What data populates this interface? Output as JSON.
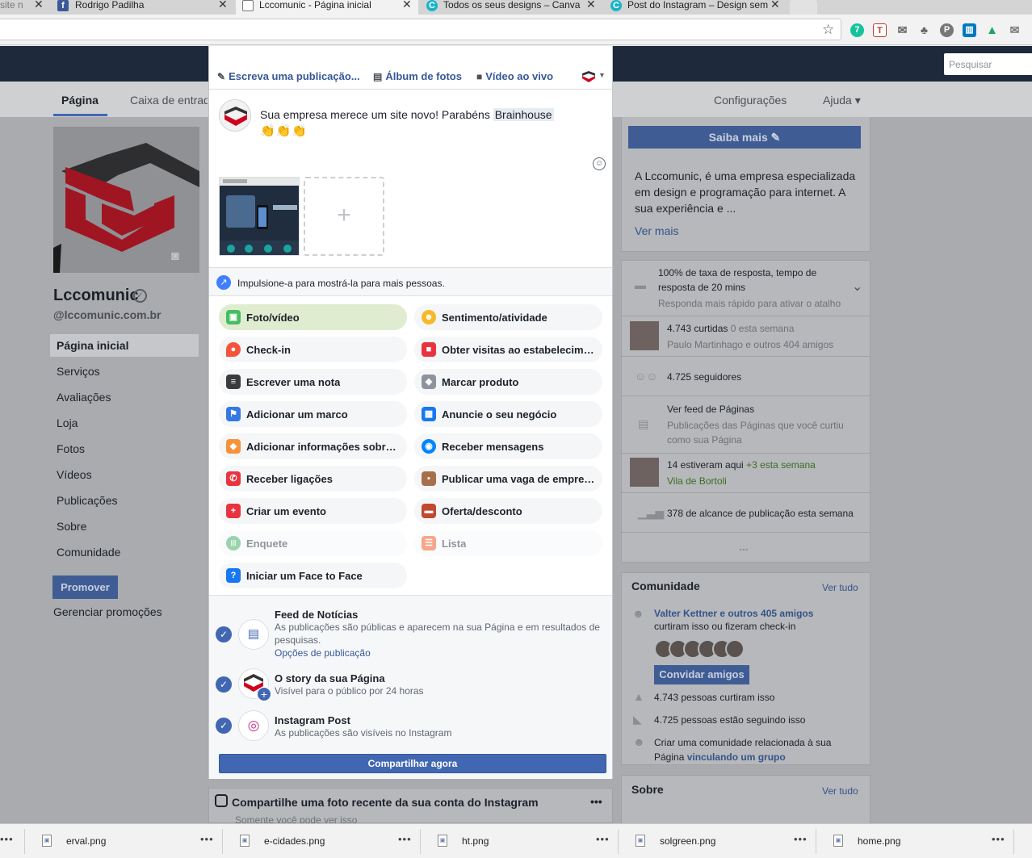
{
  "browser": {
    "tabs": [
      {
        "label": "site n",
        "favicon": ""
      },
      {
        "label": "Rodrigo Padilha",
        "favicon": "f"
      },
      {
        "label": "Lccomunic - Página inicial",
        "favicon": ""
      },
      {
        "label": "Todos os seus designs – Canva",
        "favicon": "C"
      },
      {
        "label": "Post do Instagram – Design sem",
        "favicon": "C"
      }
    ],
    "close_glyph": "✕",
    "extension_badge": "7"
  },
  "fb": {
    "search_placeholder": "Pesquisar",
    "subnav": {
      "pagina": "Página",
      "caixa": "Caixa de entrada",
      "configuracoes": "Configurações",
      "ajuda": "Ajuda ▾"
    },
    "page_name": "Lccomunic",
    "page_handle": "@lccomunic.com.br",
    "left_nav": [
      "Página inicial",
      "Serviços",
      "Avaliações",
      "Loja",
      "Fotos",
      "Vídeos",
      "Publicações",
      "Sobre",
      "Comunidade"
    ],
    "promote_label": "Promover",
    "manage_promotions": "Gerenciar promoções",
    "right": {
      "saiba_mais": "Saiba mais ✎",
      "about_text": "A Lccomunic, é uma empresa especializada em design e programação para internet. A sua experiência e ...",
      "ver_mais": "Ver mais",
      "response_line1": "100% de taxa de resposta, tempo de",
      "response_line2": "resposta de 20 mins",
      "response_hint": "Responda mais rápido para ativar o atalho",
      "likes_count": "4.743 curtidas",
      "likes_week": "0 esta semana",
      "likes_friends": "Paulo Martinhago",
      "likes_friends_more": "e outros 404 amigos",
      "followers": "4.725 seguidores",
      "feed_title": "Ver feed de Páginas",
      "feed_sub": "Publicações das Páginas que você curtiu como sua Página",
      "checkins": "14 estiveram aqui",
      "checkins_week": "+3 esta semana",
      "checkins_place": "Vila de Bortoli",
      "reach": "378 de alcance de publicação esta semana",
      "more_dots": "...",
      "community_title": "Comunidade",
      "ver_tudo": "Ver tudo",
      "community_friends": "Valter Kettner e outros 405 amigos",
      "community_friends_sub": "curtiram isso ou fizeram check-in",
      "invite_friends": "Convidar amigos",
      "community_likes": "4.743 pessoas curtiram isso",
      "community_follows": "4.725 pessoas estão seguindo isso",
      "community_group_text": "Criar uma comunidade relacionada à sua Página",
      "community_group_link": "vinculando um grupo",
      "about_title": "Sobre",
      "about_ver_tudo": "Ver tudo"
    },
    "instagram_card_title": "Compartilhe uma foto recente da sua conta do Instagram",
    "instagram_card_sub": "Somente você pode ver isso"
  },
  "composer": {
    "tabs": [
      {
        "icon": "pencil-icon",
        "glyph": "✎",
        "label": "Escreva uma publicação..."
      },
      {
        "icon": "photo-album-icon",
        "glyph": "▤",
        "label": "Álbum de fotos"
      },
      {
        "icon": "video-camera-icon",
        "glyph": "■",
        "label": "Vídeo ao vivo"
      }
    ],
    "post_text": "Sua empresa merece um site novo! Parabéns",
    "mention": "Brainhouse",
    "clap_emoji": "👏👏👏",
    "add_media_glyph": "+",
    "boost_text": "Impulsione-a para mostrá-la para mais pessoas.",
    "actions": [
      {
        "label": "Foto/vídeo",
        "icon": "photo-video-icon",
        "glyph": "▣",
        "color": "#45bd62",
        "state": "selected"
      },
      {
        "label": "Sentimento/atividade",
        "icon": "smiley-icon",
        "glyph": "☻",
        "color": "#f7b928",
        "state": "normal"
      },
      {
        "label": "Check-in",
        "icon": "location-pin-icon",
        "glyph": "●",
        "color": "#f5533d",
        "state": "normal"
      },
      {
        "label": "Obter visitas ao estabelecimento",
        "icon": "shopping-bag-icon",
        "glyph": "■",
        "color": "#e9343f",
        "state": "normal"
      },
      {
        "label": "Escrever uma nota",
        "icon": "note-icon",
        "glyph": "≡",
        "color": "#3a3b3c",
        "state": "normal"
      },
      {
        "label": "Marcar produto",
        "icon": "tag-icon",
        "glyph": "◆",
        "color": "#8d949e",
        "state": "normal"
      },
      {
        "label": "Adicionar um marco",
        "icon": "flag-icon",
        "glyph": "⚑",
        "color": "#3578e5",
        "state": "normal"
      },
      {
        "label": "Anuncie o seu negócio",
        "icon": "ad-icon",
        "glyph": "▦",
        "color": "#1877f2",
        "state": "normal"
      },
      {
        "label": "Adicionar informações sobre o produto",
        "icon": "arrow-diamond-icon",
        "glyph": "◆",
        "color": "#f7923b",
        "state": "normal"
      },
      {
        "label": "Receber mensagens",
        "icon": "messenger-icon",
        "glyph": "◉",
        "color": "#0084ff",
        "state": "normal"
      },
      {
        "label": "Receber ligações",
        "icon": "phone-icon",
        "glyph": "✆",
        "color": "#e9343f",
        "state": "normal"
      },
      {
        "label": "Publicar uma vaga de emprego",
        "icon": "briefcase-icon",
        "glyph": "▪",
        "color": "#a8704a",
        "state": "normal"
      },
      {
        "label": "Criar um evento",
        "icon": "calendar-icon",
        "glyph": "+",
        "color": "#e9343f",
        "state": "normal"
      },
      {
        "label": "Oferta/desconto",
        "icon": "offer-icon",
        "glyph": "▬",
        "color": "#c0492f",
        "state": "normal"
      },
      {
        "label": "Enquete",
        "icon": "poll-icon",
        "glyph": "|||",
        "color": "#9bd3ab",
        "state": "disabled"
      },
      {
        "label": "Lista",
        "icon": "list-icon",
        "glyph": "☰",
        "color": "#f6a68a",
        "state": "disabled"
      },
      {
        "label": "Iniciar um Face to Face",
        "icon": "question-bubble-icon",
        "glyph": "?",
        "color": "#1877f2",
        "state": "normal"
      }
    ],
    "destinations": [
      {
        "title": "Feed de Notícias",
        "sub": "As publicações são públicas e aparecem na sua Página e em resultados de pesquisas.",
        "link": "Opções de publicação",
        "icon": "news-feed-icon",
        "glyph": "▤"
      },
      {
        "title": "O story da sua Página",
        "sub": "Visível para o público por 24 horas",
        "link": "",
        "icon": "page-story-icon",
        "glyph": "+"
      },
      {
        "title": "Instagram Post",
        "sub": "As publicações são visíveis no Instagram",
        "link": "",
        "icon": "instagram-icon",
        "glyph": "◎"
      }
    ],
    "check_glyph": "✓",
    "share_now": "Compartilhar agora"
  },
  "downloads": [
    {
      "name": "erval.png"
    },
    {
      "name": "e-cidades.png"
    },
    {
      "name": "ht.png"
    },
    {
      "name": "solgreen.png"
    },
    {
      "name": "home.png"
    }
  ],
  "download_more_glyph": "•••",
  "colors": {
    "fb_blue": "#4267b2",
    "fb_dark": "#1e2a3b",
    "brand_red": "#d0021b"
  }
}
